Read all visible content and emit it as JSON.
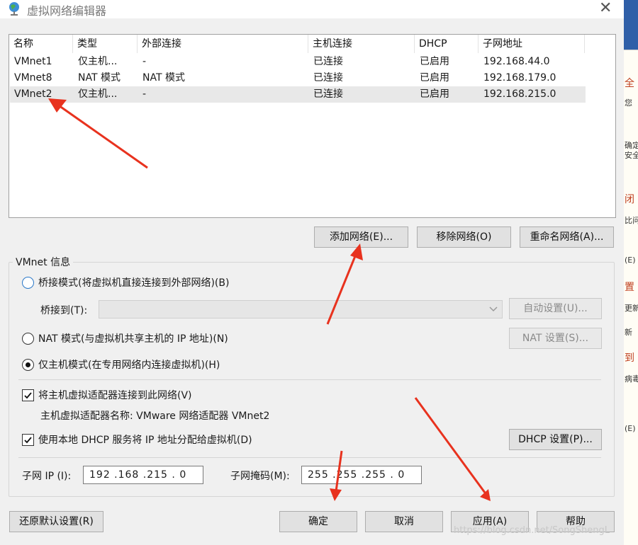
{
  "window": {
    "title": "虚拟网络编辑器",
    "close_symbol": "✕"
  },
  "network_table": {
    "columns": [
      "名称",
      "类型",
      "外部连接",
      "主机连接",
      "DHCP",
      "子网地址"
    ],
    "rows": [
      {
        "name": "VMnet1",
        "type": "仅主机...",
        "external": "-",
        "host": "已连接",
        "dhcp": "已启用",
        "subnet": "192.168.44.0"
      },
      {
        "name": "VMnet8",
        "type": "NAT 模式",
        "external": "NAT 模式",
        "host": "已连接",
        "dhcp": "已启用",
        "subnet": "192.168.179.0"
      },
      {
        "name": "VMnet2",
        "type": "仅主机...",
        "external": "-",
        "host": "已连接",
        "dhcp": "已启用",
        "subnet": "192.168.215.0"
      }
    ],
    "selected_row": "VMnet2"
  },
  "table_buttons": {
    "add": "添加网络(E)...",
    "remove": "移除网络(O)",
    "rename": "重命名网络(A)..."
  },
  "vmnet_info": {
    "group_title": "VMnet 信息",
    "bridge_mode": "桥接模式(将虚拟机直接连接到外部网络)(B)",
    "bridge_to_label": "桥接到(T):",
    "auto_settings": "自动设置(U)...",
    "nat_mode": "NAT 模式(与虚拟机共享主机的 IP 地址)(N)",
    "nat_settings": "NAT 设置(S)...",
    "host_only_mode": "仅主机模式(在专用网络内连接虚拟机)(H)",
    "selected_mode": "host_only",
    "connect_adapter": "将主机虚拟适配器连接到此网络(V)",
    "connect_adapter_checked": true,
    "adapter_name": "主机虚拟适配器名称: VMware 网络适配器 VMnet2",
    "use_dhcp": "使用本地 DHCP 服务将 IP 地址分配给虚拟机(D)",
    "use_dhcp_checked": true,
    "dhcp_settings": "DHCP 设置(P)...",
    "subnet_ip_label": "子网 IP (I):",
    "subnet_ip": "192 .168 .215 .  0",
    "subnet_mask_label": "子网掩码(M):",
    "subnet_mask": "255 .255 .255 .  0"
  },
  "footer": {
    "restore": "还原默认设置(R)",
    "ok": "确定",
    "cancel": "取消",
    "apply": "应用(A)",
    "help": "帮助"
  },
  "background_window": {
    "items": [
      "全",
      "您",
      "确定",
      "安全",
      "闭",
      "比问",
      "(E)",
      "置",
      "更新",
      "新",
      "到",
      "病毒",
      "(E)"
    ]
  },
  "watermark": "https://blog.csdn.net/SongShengL",
  "colors": {
    "arrow": "#e8321e",
    "selected_row": "#e8e8e8",
    "dialog_bg": "#f0f0f0"
  }
}
